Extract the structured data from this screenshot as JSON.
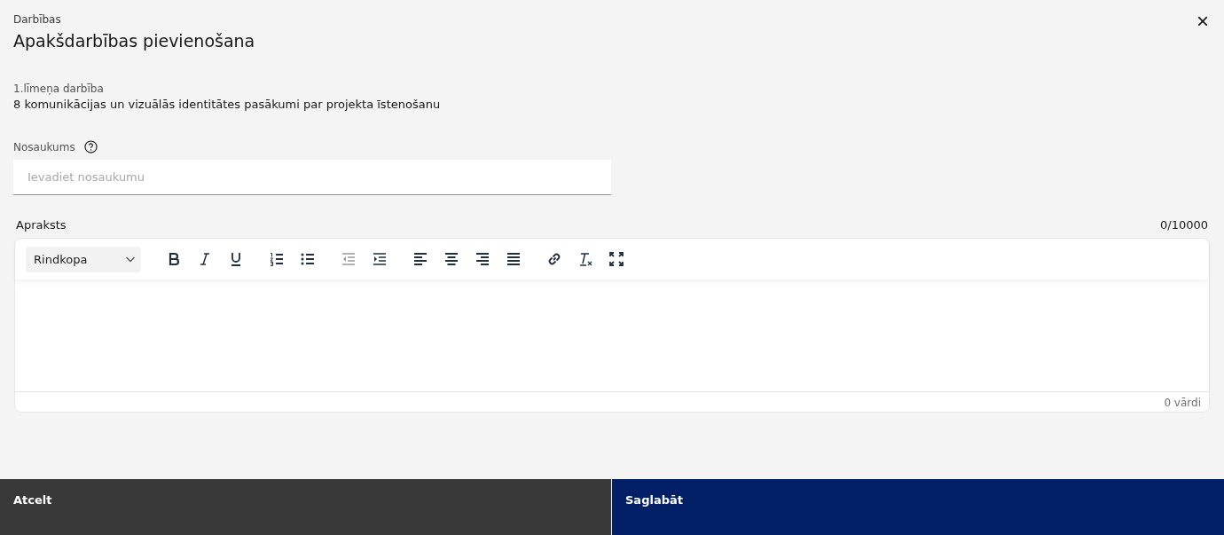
{
  "header": {
    "breadcrumb": "Darbības",
    "title": "Apakšdarbības pievienošana",
    "close": "×"
  },
  "parent_activity": {
    "label": "1.līmeņa darbība",
    "value": "8 komunikācijas un vizuālās identitātes pasākumi par projekta īstenošanu"
  },
  "name_field": {
    "label": "Nosaukums",
    "placeholder": "Ievadiet nosaukumu"
  },
  "description": {
    "label": "Apraksts",
    "counter": "0/10000",
    "format_select": "Rindkopa",
    "word_count": "0 vārdi",
    "toolbar": [
      [
        {
          "kind": "bold",
          "disabled": false
        },
        {
          "kind": "italic",
          "disabled": false
        },
        {
          "kind": "underline",
          "disabled": false
        }
      ],
      [
        {
          "kind": "ordered-list",
          "disabled": false
        },
        {
          "kind": "bullet-list",
          "disabled": false
        }
      ],
      [
        {
          "kind": "outdent",
          "disabled": true
        },
        {
          "kind": "indent",
          "disabled": false
        }
      ],
      [
        {
          "kind": "align-left",
          "disabled": false
        },
        {
          "kind": "align-center",
          "disabled": false
        },
        {
          "kind": "align-right",
          "disabled": false
        },
        {
          "kind": "justify",
          "disabled": false
        }
      ],
      [
        {
          "kind": "link",
          "disabled": false
        },
        {
          "kind": "clear-format",
          "disabled": false
        },
        {
          "kind": "fullscreen",
          "disabled": false
        }
      ]
    ]
  },
  "footer": {
    "cancel": "Atcelt",
    "save": "Saglabāt"
  }
}
